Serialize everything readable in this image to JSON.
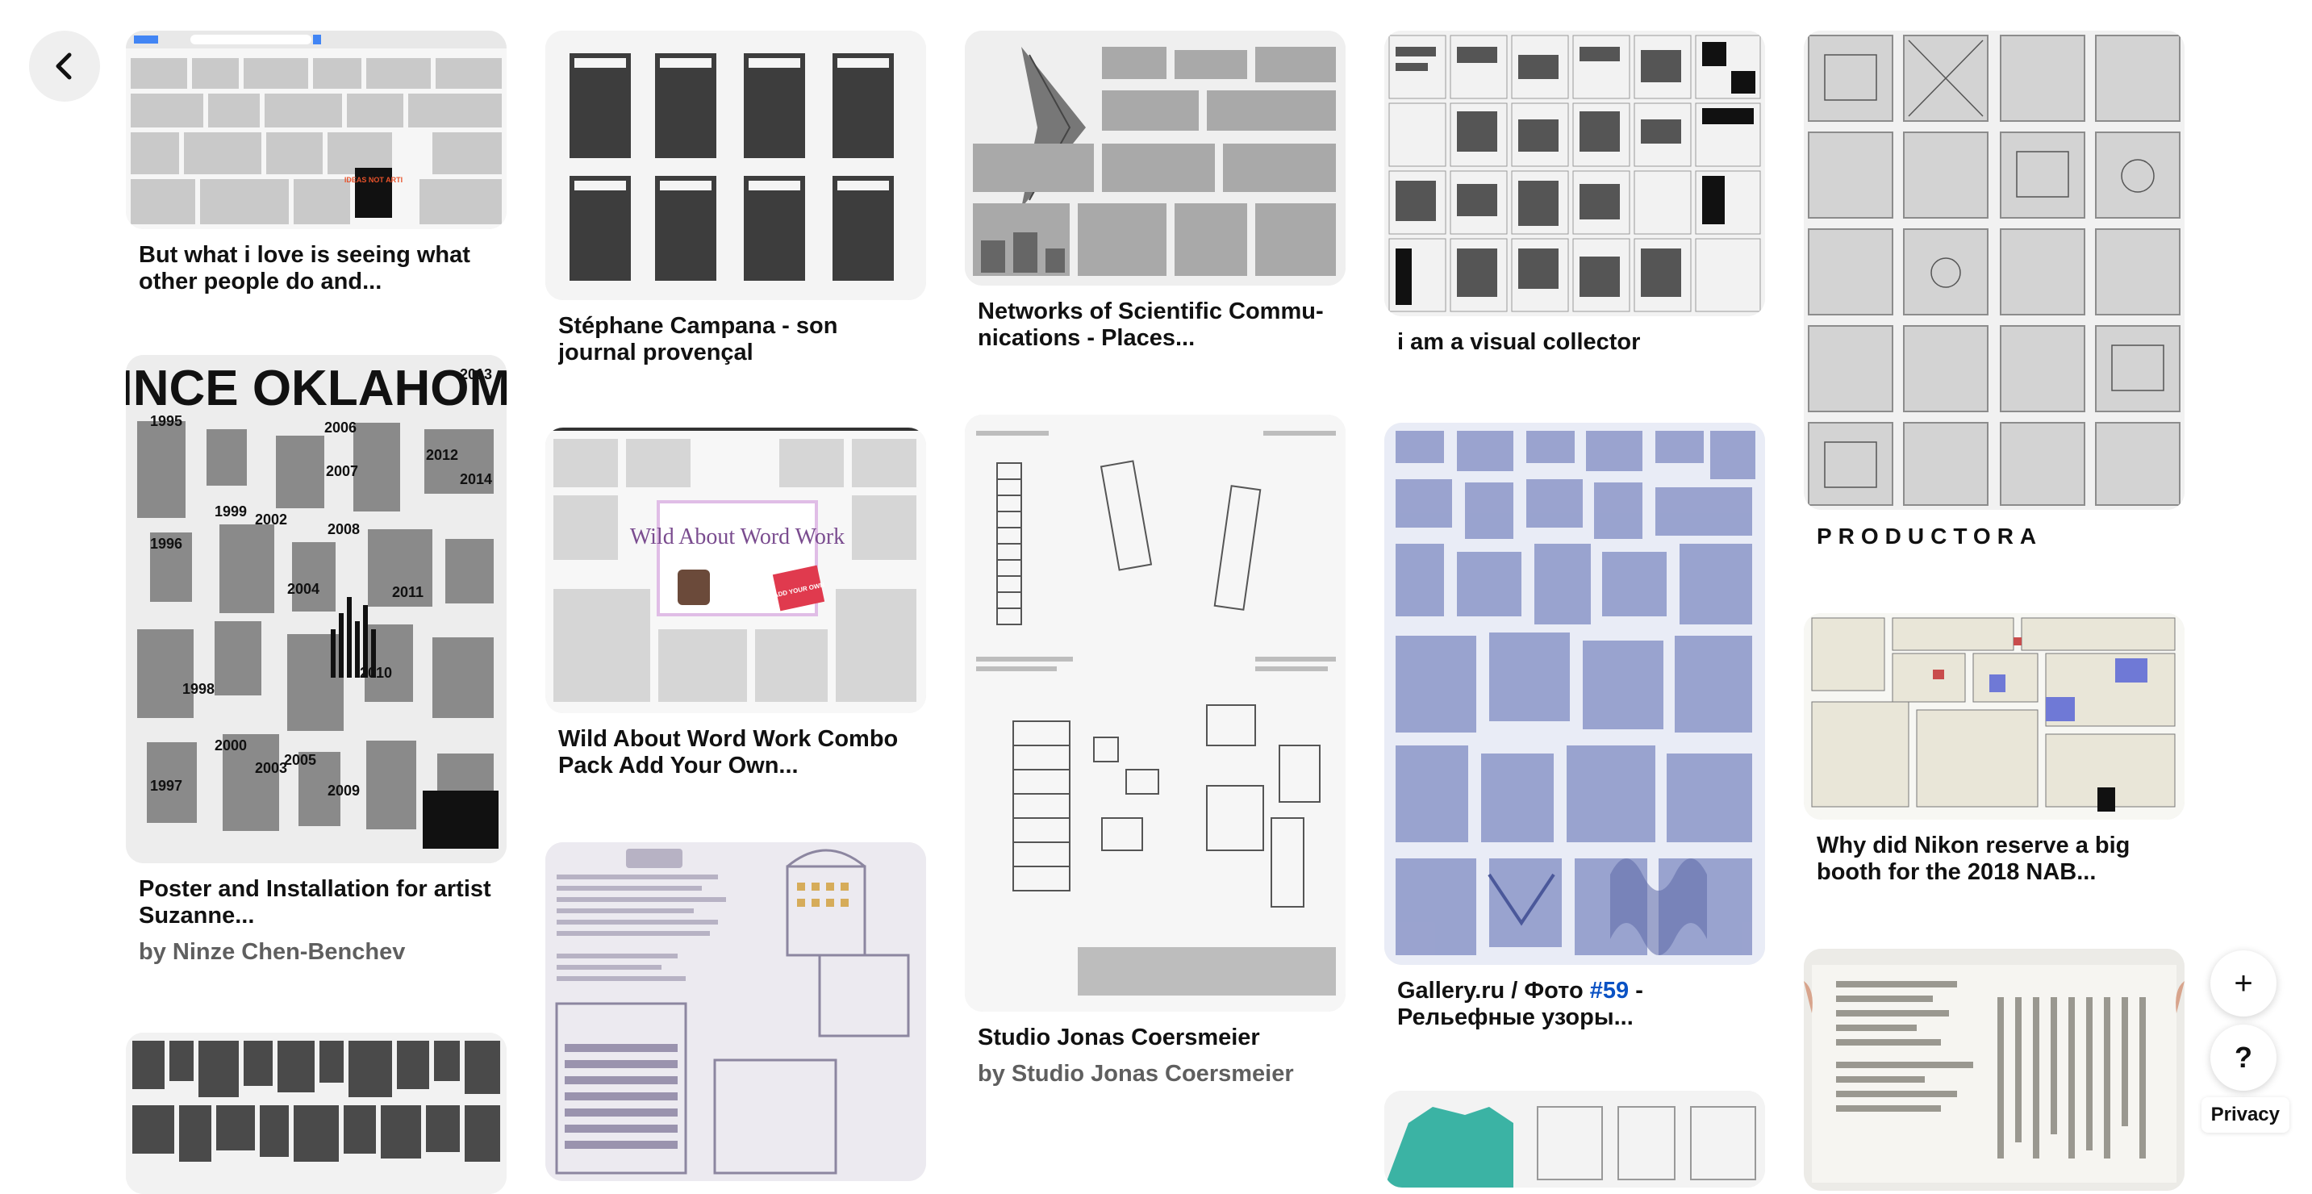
{
  "nav": {
    "back_icon": "chevron-left-icon"
  },
  "pins": {
    "p1": {
      "title": "But what i love is seeing what other people do and..."
    },
    "p2": {
      "title": "Poster and Installation for artist Suzanne...",
      "byline": "by Ninze Chen-Benchev"
    },
    "p4": {
      "title": "Stéphane Campana - son journal provençal"
    },
    "p5": {
      "title": "Wild About Word Work Combo Pack Add Your Own..."
    },
    "p7": {
      "title": "Networks of Scientific Commu- nications - Places..."
    },
    "p8": {
      "title": "Studio Jonas Coersmeier",
      "byline": "by Studio Jonas Coersmeier"
    },
    "p9": {
      "title": "i am a visual collector"
    },
    "p10": {
      "title_prefix": "Gallery.ru / Фото ",
      "title_tag": "#59",
      "title_suffix": " - Рельефные узоры..."
    },
    "p12": {
      "title": "PRODUCTORA"
    },
    "p13": {
      "title": "Why did Nikon reserve a big booth for the 2018 NAB..."
    }
  },
  "thumb_text": {
    "p1_stamp": "IDEAS NOT ARTI",
    "p2_heading": "SINCE OKLAHOMA",
    "p2_years": [
      "1995",
      "1996",
      "1997",
      "1998",
      "1999",
      "2000",
      "2002",
      "2003",
      "2004",
      "2005",
      "2006",
      "2007",
      "2008",
      "2009",
      "2010",
      "2011",
      "2012",
      "2013",
      "2014"
    ],
    "p5_banner": "Wild About Word Work",
    "p5_badge": "ADD YOUR OWN"
  },
  "actions": {
    "add_label": "+",
    "help_label": "?",
    "privacy_label": "Privacy"
  },
  "colors": {
    "accent_link": "#0a52c4",
    "button_bg": "#efefef"
  }
}
